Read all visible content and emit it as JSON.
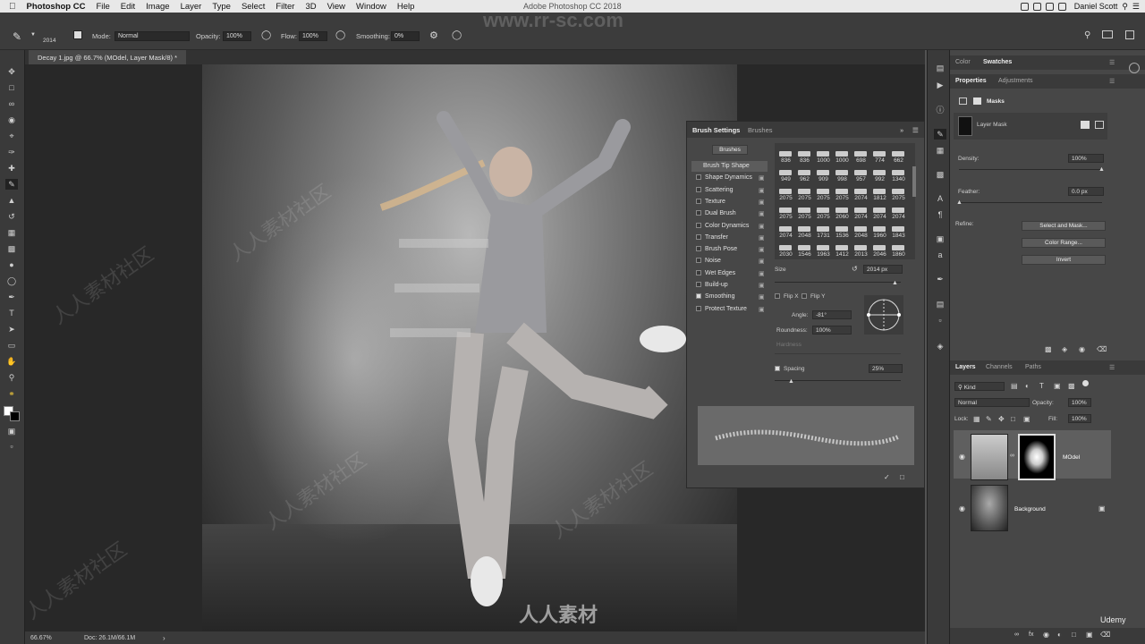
{
  "menubar": {
    "app_name": "Photoshop CC",
    "items": [
      "File",
      "Edit",
      "Image",
      "Layer",
      "Type",
      "Select",
      "Filter",
      "3D",
      "View",
      "Window",
      "Help"
    ],
    "window_title": "Adobe Photoshop CC 2018",
    "user": "Daniel Scott"
  },
  "options_bar": {
    "brush_size": "2014",
    "mode_label": "Mode:",
    "mode_value": "Normal",
    "opacity_label": "Opacity:",
    "opacity_value": "100%",
    "flow_label": "Flow:",
    "flow_value": "100%",
    "smoothing_label": "Smoothing:",
    "smoothing_value": "0%"
  },
  "document": {
    "tab_title": "Decay 1.jpg @ 66.7% (MOdel, Layer Mask/8) *"
  },
  "status_bar": {
    "zoom": "66.67%",
    "doc_size": "Doc: 26.1M/66.1M"
  },
  "brush_settings": {
    "tabs": [
      "Brush Settings",
      "Brushes"
    ],
    "brushes_button": "Brushes",
    "items": [
      {
        "label": "Brush Tip Shape",
        "checked": null,
        "selected": true
      },
      {
        "label": "Shape Dynamics",
        "checked": false
      },
      {
        "label": "Scattering",
        "checked": false
      },
      {
        "label": "Texture",
        "checked": false
      },
      {
        "label": "Dual Brush",
        "checked": false
      },
      {
        "label": "Color Dynamics",
        "checked": false
      },
      {
        "label": "Transfer",
        "checked": false
      },
      {
        "label": "Brush Pose",
        "checked": false
      },
      {
        "label": "Noise",
        "checked": false
      },
      {
        "label": "Wet Edges",
        "checked": false
      },
      {
        "label": "Build-up",
        "checked": false
      },
      {
        "label": "Smoothing",
        "checked": true
      },
      {
        "label": "Protect Texture",
        "checked": false
      }
    ],
    "tip_sizes": [
      [
        "836",
        "836",
        "1000",
        "1000",
        "698",
        "774",
        "662"
      ],
      [
        "949",
        "962",
        "909",
        "998",
        "957",
        "992",
        "1340"
      ],
      [
        "2075",
        "2075",
        "2075",
        "2075",
        "2074",
        "1812",
        "2075"
      ],
      [
        "2075",
        "2075",
        "2075",
        "2060",
        "2074",
        "2074",
        "2074"
      ],
      [
        "2074",
        "2048",
        "1731",
        "1536",
        "2048",
        "1960",
        "1843"
      ],
      [
        "2030",
        "1546",
        "1963",
        "1412",
        "2013",
        "2046",
        "1860"
      ]
    ],
    "size_label": "Size",
    "size_value": "2014 px",
    "flip_x": "Flip X",
    "flip_y": "Flip Y",
    "angle_label": "Angle:",
    "angle_value": "-81°",
    "roundness_label": "Roundness:",
    "roundness_value": "100%",
    "hardness_label": "Hardness",
    "spacing_label": "Spacing",
    "spacing_value": "25%"
  },
  "properties_panel": {
    "top_tabs": [
      "Color",
      "Swatches"
    ],
    "tabs": [
      "Properties",
      "Adjustments"
    ],
    "masks_label": "Masks",
    "layer_mask_label": "Layer Mask",
    "density_label": "Density:",
    "density_value": "100%",
    "feather_label": "Feather:",
    "feather_value": "0.0 px",
    "refine_label": "Refine:",
    "select_and_mask": "Select and Mask...",
    "color_range": "Color Range...",
    "invert": "Invert"
  },
  "layers_panel": {
    "tabs": [
      "Layers",
      "Channels",
      "Paths"
    ],
    "filter_kind": "Kind",
    "blend_mode": "Normal",
    "opacity_label": "Opacity:",
    "opacity_value": "100%",
    "lock_label": "Lock:",
    "fill_label": "Fill:",
    "fill_value": "100%",
    "layers": [
      {
        "name": "MOdel",
        "selected": true
      },
      {
        "name": "Background",
        "selected": false
      }
    ]
  },
  "overlay": {
    "watermark_url": "www.rr-sc.com",
    "watermark_cn": "人人素材社区",
    "logo_text": "人人素材",
    "udemy": "Udemy"
  },
  "colors": {
    "menubar_bg": "#e8e8e8",
    "panel_bg": "#474747",
    "toolbar_bg": "#3a3a3a",
    "canvas_bg": "#282828",
    "selected_layer": "#5f5f5f"
  }
}
